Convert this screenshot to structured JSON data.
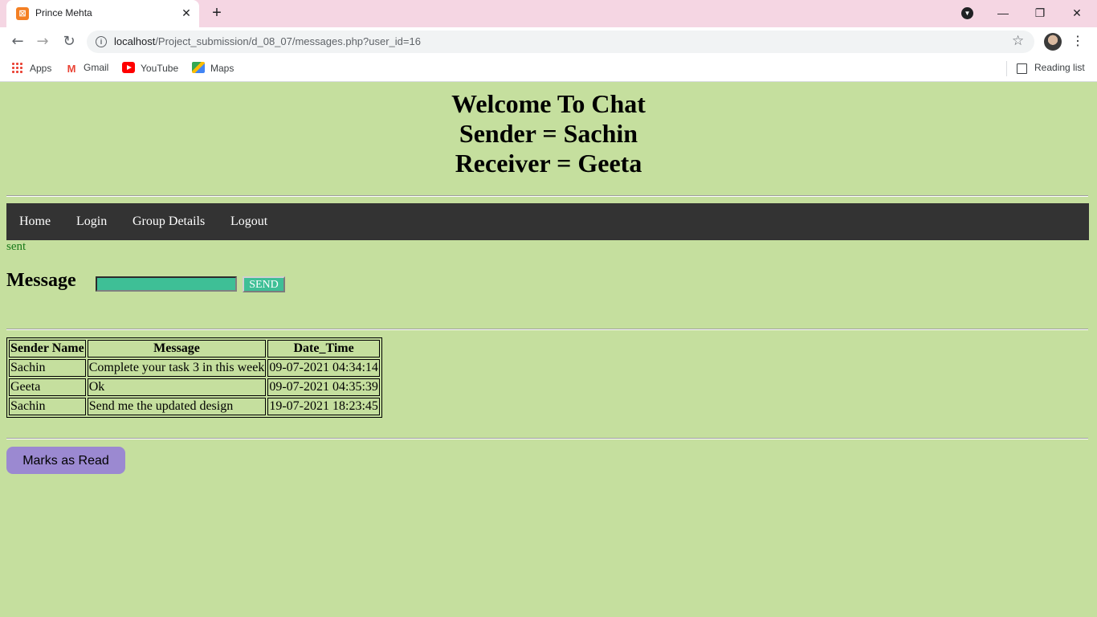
{
  "browser": {
    "tab_title": "Prince Mehta",
    "favicon_glyph": "⊠",
    "url_host": "localhost",
    "url_path": "/Project_submission/d_08_07/messages.php?user_id=16",
    "bookmarks": [
      {
        "label": "Apps",
        "icon": "apps-grid-icon"
      },
      {
        "label": "Gmail",
        "icon": "gmail-icon"
      },
      {
        "label": "YouTube",
        "icon": "youtube-icon"
      },
      {
        "label": "Maps",
        "icon": "maps-icon"
      }
    ],
    "reading_list": "Reading list"
  },
  "header": {
    "line1": "Welcome To Chat",
    "line2": "Sender = Sachin",
    "line3": "Receiver = Geeta"
  },
  "nav": {
    "items": [
      {
        "label": "Home"
      },
      {
        "label": "Login"
      },
      {
        "label": "Group Details"
      },
      {
        "label": "Logout"
      }
    ]
  },
  "status_text": "sent",
  "compose": {
    "label": "Message",
    "input_value": "",
    "send_label": "SEND"
  },
  "table": {
    "headers": [
      "Sender Name",
      "Message",
      "Date_Time"
    ],
    "rows": [
      [
        "Sachin",
        "Complete your task 3 in this week",
        "09-07-2021 04:34:14"
      ],
      [
        "Geeta",
        "Ok",
        "09-07-2021 04:35:39"
      ],
      [
        "Sachin",
        "Send me the updated design",
        "19-07-2021 18:23:45"
      ]
    ]
  },
  "mark_read_label": "Marks as Read",
  "colors": {
    "page_background": "#c5df9e",
    "navbar": "#333333",
    "send_button": "#3ebf96",
    "mark_read_button": "#9b89d1",
    "status_text": "#1a7a1a",
    "tabstrip": "#f5d6e3"
  }
}
